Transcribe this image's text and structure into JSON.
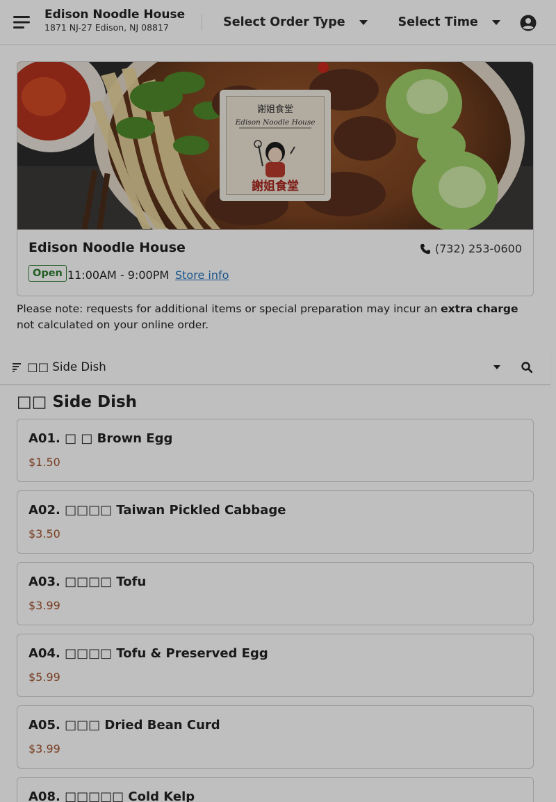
{
  "header": {
    "restaurant_name": "Edison Noodle House",
    "address": "1871 NJ-27 Edison, NJ 08817",
    "order_type_label": "Select Order Type",
    "time_label": "Select Time"
  },
  "store": {
    "name": "Edison Noodle House",
    "phone": "(732) 253-0600",
    "status": "Open",
    "hours": "11:00AM - 9:00PM",
    "store_info_link": "Store info",
    "logo_text_cn": "謝姐食堂",
    "logo_text_en": "Edison Noodle House"
  },
  "notice": {
    "before": "Please note: requests for additional items or special preparation may incur an ",
    "bold": "extra charge",
    "after": " not calculated on your online order."
  },
  "category_bar": {
    "selected": "□□ Side Dish"
  },
  "section": {
    "title": "□□ Side Dish"
  },
  "items": [
    {
      "name": "A01. □ □ Brown Egg",
      "price": "$1.50"
    },
    {
      "name": "A02. □□□□ Taiwan Pickled Cabbage",
      "price": "$3.50"
    },
    {
      "name": "A03. □□□□ Tofu",
      "price": "$3.99"
    },
    {
      "name": "A04. □□□□ Tofu & Preserved Egg",
      "price": "$5.99"
    },
    {
      "name": "A05. □□□ Dried Bean Curd",
      "price": "$3.99"
    },
    {
      "name": "A08. □□□□□ Cold Kelp",
      "price": ""
    }
  ],
  "colors": {
    "price": "#a0522d",
    "link": "#1d6fb8",
    "open": "#2e7d32"
  }
}
